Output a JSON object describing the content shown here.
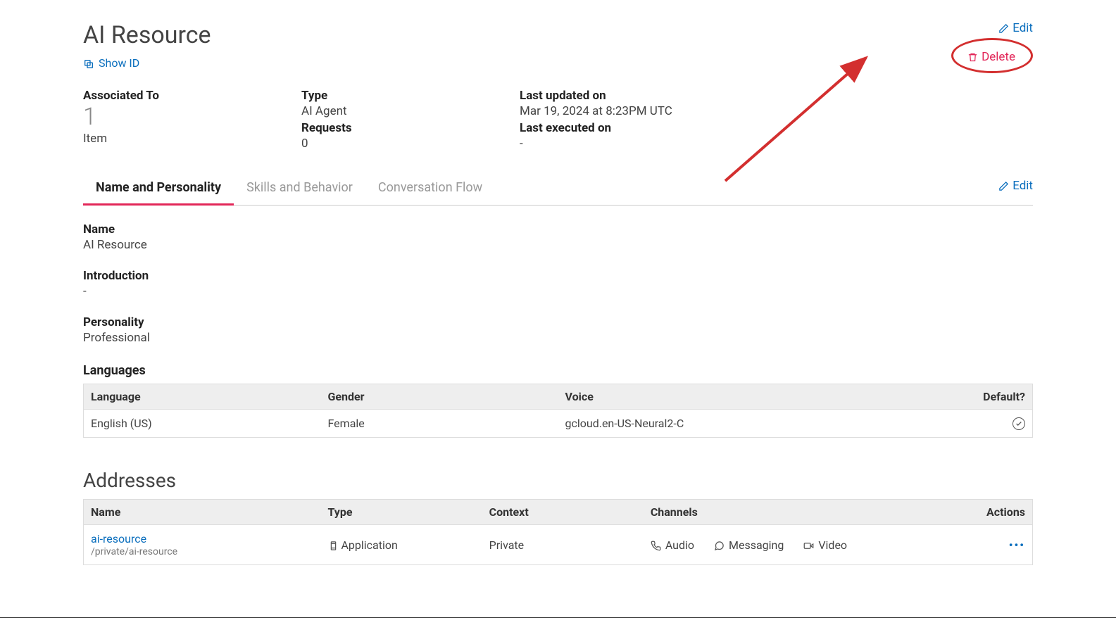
{
  "header": {
    "title": "AI Resource",
    "show_id_label": "Show ID",
    "edit_label": "Edit",
    "delete_label": "Delete"
  },
  "meta": {
    "associated_label": "Associated To",
    "associated_count": "1",
    "associated_item": "Item",
    "type_label": "Type",
    "type_value": "AI Agent",
    "requests_label": "Requests",
    "requests_value": "0",
    "last_updated_label": "Last updated on",
    "last_updated_value": "Mar 19, 2024 at 8:23PM UTC",
    "last_executed_label": "Last executed on",
    "last_executed_value": "-"
  },
  "tabs": {
    "name_personality": "Name and Personality",
    "skills_behavior": "Skills and Behavior",
    "conversation_flow": "Conversation Flow",
    "edit_label": "Edit"
  },
  "details": {
    "name_label": "Name",
    "name_value": "AI Resource",
    "intro_label": "Introduction",
    "intro_value": "-",
    "personality_label": "Personality",
    "personality_value": "Professional",
    "languages_label": "Languages"
  },
  "lang_table": {
    "headers": {
      "language": "Language",
      "gender": "Gender",
      "voice": "Voice",
      "default": "Default?"
    },
    "rows": [
      {
        "language": "English (US)",
        "gender": "Female",
        "voice": "gcloud.en-US-Neural2-C",
        "is_default": true
      }
    ]
  },
  "addresses": {
    "title": "Addresses",
    "headers": {
      "name": "Name",
      "type": "Type",
      "context": "Context",
      "channels": "Channels",
      "actions": "Actions"
    },
    "rows": [
      {
        "name": "ai-resource",
        "path": "/private/ai-resource",
        "type": "Application",
        "context": "Private",
        "channels": {
          "audio": "Audio",
          "messaging": "Messaging",
          "video": "Video"
        }
      }
    ]
  }
}
